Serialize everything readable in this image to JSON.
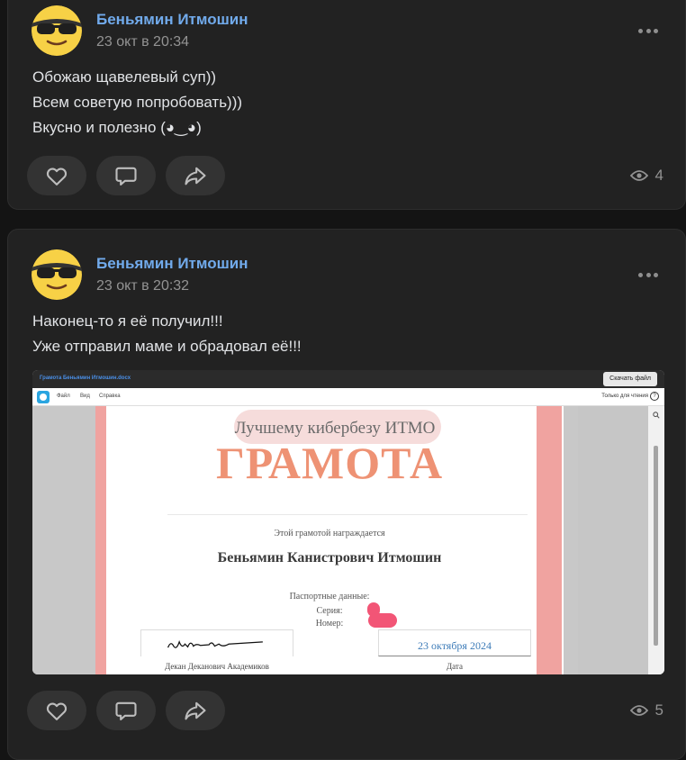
{
  "posts": [
    {
      "author": "Беньямин Итмошин",
      "time": "23 окт в 20:34",
      "text": "Обожаю щавелевый суп))\nВсем советую попробовать)))\nВкусно и полезно (◕‿◕)",
      "views": "4"
    },
    {
      "author": "Беньямин Итмошин",
      "time": "23 окт в 20:32",
      "text": "Наконец-то я её получил!!!\nУже отправил маме и обрадовал её!!!",
      "views": "5",
      "attachment": {
        "filename": "Грамота Беньямин Итмошин.docx",
        "download_label": "Скачать файл",
        "menu": [
          "Файл",
          "Вид",
          "Справка"
        ],
        "read_only": "Только для чтения",
        "help": "?",
        "certificate": {
          "award_line": "Лучшему кибербезу ИТМО",
          "title": "ГРАМОТА",
          "awarded_text": "Этой грамотой награждается",
          "recipient": "Беньямин Канистрович Итмошин",
          "passport_label": "Паспортные данные:",
          "series_label": "Серия:",
          "number_label": "Номер:",
          "date": "23 октября 2024",
          "signer": "Декан Деканович Академиков",
          "date_label": "Дата"
        }
      }
    }
  ],
  "icons": {
    "like": "heart-icon",
    "comment": "comment-icon",
    "share": "share-icon",
    "views": "eye-icon",
    "more": "more-icon"
  },
  "colors": {
    "author": "#71aaeb",
    "accent_title": "#ee9274",
    "page_strip": "#f0a3a0",
    "redaction": "#f25576"
  }
}
